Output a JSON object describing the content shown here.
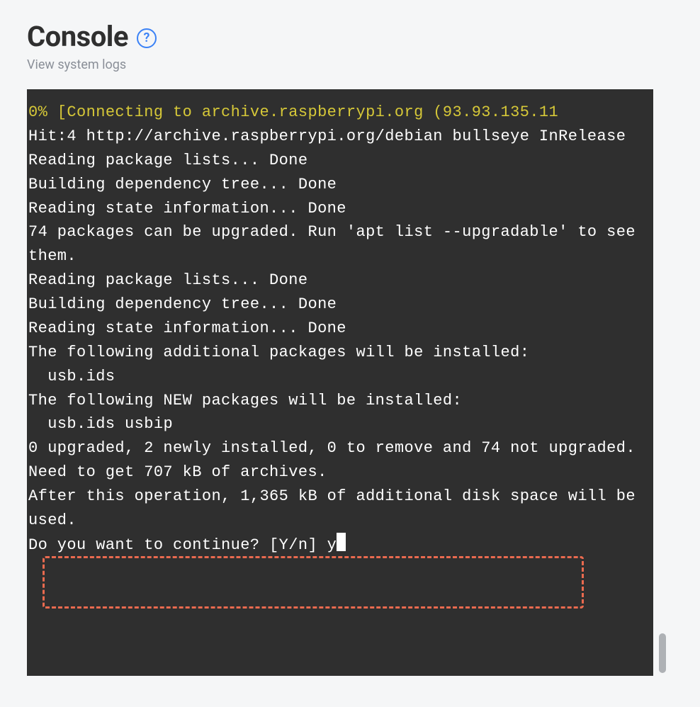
{
  "header": {
    "title": "Console",
    "help_glyph": "?",
    "subtitle": "View system logs"
  },
  "terminal": {
    "status_line": "0% [Connecting to archive.raspberrypi.org (93.93.135.11",
    "lines": [
      "",
      "Hit:4 http://archive.raspberrypi.org/debian bullseye InRelease",
      "Reading package lists... Done",
      "Building dependency tree... Done",
      "Reading state information... Done",
      "74 packages can be upgraded. Run 'apt list --upgradable' to see them.",
      "Reading package lists... Done",
      "Building dependency tree... Done",
      "Reading state information... Done",
      "The following additional packages will be installed:",
      "  usb.ids",
      "The following NEW packages will be installed:",
      "  usb.ids usbip",
      "0 upgraded, 2 newly installed, 0 to remove and 74 not upgraded.",
      "Need to get 707 kB of archives.",
      "After this operation, 1,365 kB of additional disk space will be used."
    ],
    "prompt_line": "Do you want to continue? [Y/n] y"
  }
}
